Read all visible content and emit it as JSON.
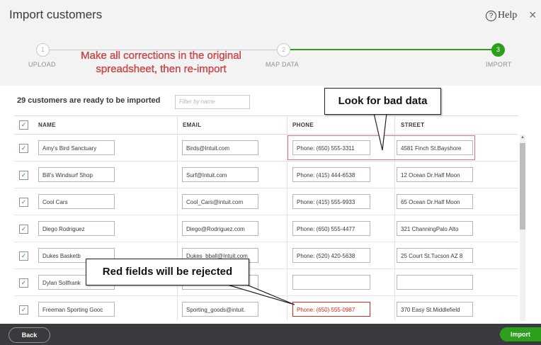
{
  "header": {
    "title": "Import customers",
    "help_label": "Help",
    "help_icon": "?",
    "close_icon": "×"
  },
  "steps": [
    {
      "number": "1",
      "label": "UPLOAD"
    },
    {
      "number": "2",
      "label": "MAP DATA"
    },
    {
      "number": "3",
      "label": "IMPORT"
    }
  ],
  "annotations": {
    "corrections_line1": "Make all corrections in the original",
    "corrections_line2": "spreadsheet, then re-import",
    "bad_data": "Look for bad data",
    "rejected": "Red fields will be rejected"
  },
  "summary": {
    "ready_text": "29 customers are ready to be imported",
    "filter_placeholder": "Filter by name"
  },
  "columns": {
    "name": "NAME",
    "email": "EMAIL",
    "phone": "PHONE",
    "street": "STREET"
  },
  "rows": [
    {
      "name": "Amy's Bird Sanctuary",
      "email": "Birds@Intuit.com",
      "phone": "Phone: (650) 555-3311",
      "street": "4581 Finch St.Bayshore"
    },
    {
      "name": "Bill's Windsurf Shop",
      "email": "Surf@Intuit.com",
      "phone": "Phone: (415) 444-6538",
      "street": "12 Ocean Dr.Half Moon"
    },
    {
      "name": "Cool Cars",
      "email": "Cool_Cars@intuit.com",
      "phone": "Phone: (415) 555-9933",
      "street": "65 Ocean Dr.Half Moon"
    },
    {
      "name": "Diego Rodriguez",
      "email": "Diego@Rodriguez.com",
      "phone": "Phone: (650) 555-4477",
      "street": "321 ChanningPalo Alto"
    },
    {
      "name": "Dukes Basketb",
      "email": "Dukes_bball@Intuit.com",
      "phone": "Phone: (520) 420-5638",
      "street": "25 Court St.Tucson AZ 8"
    },
    {
      "name": "Dylan Sollfrank",
      "email": "",
      "phone": "",
      "street": ""
    },
    {
      "name": "Freeman Sporting Gooc",
      "email": "Sporting_goods@intuit.",
      "phone": "Phone: (650) 555-0987",
      "street": "370 Easy St.Middlefield"
    }
  ],
  "footer": {
    "back_label": "Back",
    "import_label": "Import"
  },
  "colors": {
    "accent_green": "#2ca01c",
    "error_red": "#d52b1e",
    "annotation_red": "#e05252",
    "footer_bg": "#393a3d"
  }
}
